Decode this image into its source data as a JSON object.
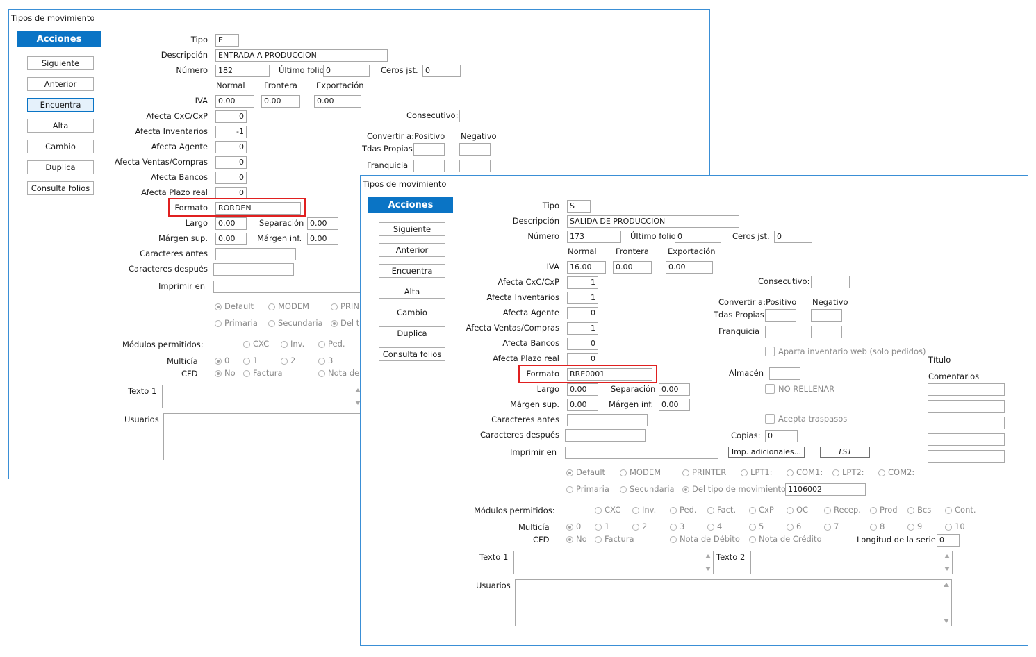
{
  "back": {
    "title": "Tipos de movimiento",
    "acciones": "Acciones",
    "buttons": [
      "Siguiente",
      "Anterior",
      "Encuentra",
      "Alta",
      "Cambio",
      "Duplica",
      "Consulta folios"
    ],
    "labels": {
      "tipo": "Tipo",
      "descripcion": "Descripción",
      "numero": "Número",
      "ultimo_folio": "Último folio",
      "ceros": "Ceros jst.",
      "normal": "Normal",
      "frontera": "Frontera",
      "exportacion": "Exportación",
      "iva": "IVA",
      "cxc": "Afecta  CxC/CxP",
      "inv": "Afecta  Inventarios",
      "agente": "Afecta  Agente",
      "ventas": "Afecta  Ventas/Compras",
      "bancos": "Afecta  Bancos",
      "plazo": "Afecta  Plazo real",
      "formato": "Formato",
      "largo": "Largo",
      "separacion": "Separación",
      "margen_sup": "Márgen sup.",
      "margen_inf": "Márgen inf.",
      "car_antes": "Caracteres antes",
      "car_despues": "Caracteres después",
      "imprimir": "Imprimir en",
      "consecutivo": "Consecutivo:",
      "convertir": "Convertir a:",
      "positivo": "Positivo",
      "negativo": "Negativo",
      "tdas": "Tdas Propias",
      "franquicia": "Franquicia",
      "modulos": "Módulos permitidos:",
      "multicia": "Multicía",
      "cfd": "CFD",
      "texto1": "Texto 1",
      "usuarios": "Usuarios"
    },
    "values": {
      "tipo": "E",
      "descripcion": "ENTRADA A PRODUCCION",
      "numero": "182",
      "ultimo_folio": "0",
      "ceros": "0",
      "iva_normal": "0.00",
      "iva_frontera": "0.00",
      "iva_export": "0.00",
      "cxc": "0",
      "inv": "-1",
      "agente": "0",
      "ventas": "0",
      "bancos": "0",
      "plazo": "0",
      "formato": "RORDEN",
      "largo": "0.00",
      "separacion": "0.00",
      "margen_sup": "0.00",
      "margen_inf": "0.00"
    },
    "radios": {
      "r1": [
        "Default",
        "MODEM",
        "PRIN"
      ],
      "r2": [
        "Primaria",
        "Secundaria",
        "Del ti"
      ],
      "mod": [
        "CXC",
        "Inv.",
        "Ped."
      ],
      "mul": [
        "0",
        "1",
        "2",
        "3"
      ],
      "cfd": [
        "No",
        "Factura",
        "Nota de"
      ]
    }
  },
  "front": {
    "title": "Tipos de movimiento",
    "acciones": "Acciones",
    "buttons": [
      "Siguiente",
      "Anterior",
      "Encuentra",
      "Alta",
      "Cambio",
      "Duplica",
      "Consulta folios"
    ],
    "labels": {
      "tipo": "Tipo",
      "descripcion": "Descripción",
      "numero": "Número",
      "ultimo_folio": "Último folio",
      "ceros": "Ceros jst.",
      "normal": "Normal",
      "frontera": "Frontera",
      "exportacion": "Exportación",
      "iva": "IVA",
      "cxc": "Afecta  CxC/CxP",
      "inv": "Afecta  Inventarios",
      "agente": "Afecta  Agente",
      "ventas": "Afecta  Ventas/Compras",
      "bancos": "Afecta  Bancos",
      "plazo": "Afecta  Plazo real",
      "formato": "Formato",
      "largo": "Largo",
      "separacion": "Separación",
      "margen_sup": "Márgen sup.",
      "margen_inf": "Márgen inf.",
      "car_antes": "Caracteres antes",
      "car_despues": "Caracteres después",
      "imprimir": "Imprimir en",
      "consecutivo": "Consecutivo:",
      "convertir": "Convertir a:",
      "positivo": "Positivo",
      "negativo": "Negativo",
      "tdas": "Tdas Propias",
      "franquicia": "Franquicia",
      "aparta": "Aparta inventario web (solo pedidos)",
      "titulo": "Título",
      "comentarios": "Comentarios",
      "almacen": "Almacén",
      "no_rellenar": "NO RELLENAR",
      "acepta": "Acepta traspasos",
      "copias": "Copias:",
      "imp_adic": "Imp. adicionales...",
      "tst": "TST",
      "modulos": "Módulos permitidos:",
      "multicia": "Multicía",
      "cfd": "CFD",
      "longitud": "Longitud de la serie",
      "texto1": "Texto 1",
      "texto2": "Texto 2",
      "usuarios": "Usuarios"
    },
    "values": {
      "tipo": "S",
      "descripcion": "SALIDA DE PRODUCCION",
      "numero": "173",
      "ultimo_folio": "0",
      "ceros": "0",
      "iva_normal": "16.00",
      "iva_frontera": "0.00",
      "iva_export": "0.00",
      "cxc": "1",
      "inv": "1",
      "agente": "0",
      "ventas": "1",
      "bancos": "0",
      "plazo": "0",
      "formato": "RRE0001",
      "largo": "0.00",
      "separacion": "0.00",
      "margen_sup": "0.00",
      "margen_inf": "0.00",
      "copias": "0",
      "del_tipo": "1106002",
      "longitud": "0"
    },
    "radios": {
      "r1": [
        "Default",
        "MODEM",
        "PRINTER",
        "LPT1:",
        "COM1:",
        "LPT2:",
        "COM2:"
      ],
      "r2": [
        "Primaria",
        "Secundaria",
        "Del tipo de movimiento"
      ],
      "mod": [
        "CXC",
        "Inv.",
        "Ped.",
        "Fact.",
        "CxP",
        "OC",
        "Recep.",
        "Prod",
        "Bcs",
        "Cont."
      ],
      "mul": [
        "0",
        "1",
        "2",
        "3",
        "4",
        "5",
        "6",
        "7",
        "8",
        "9",
        "10"
      ],
      "cfd": [
        "No",
        "Factura",
        "Nota de Débito",
        "Nota de Crédito"
      ]
    }
  }
}
